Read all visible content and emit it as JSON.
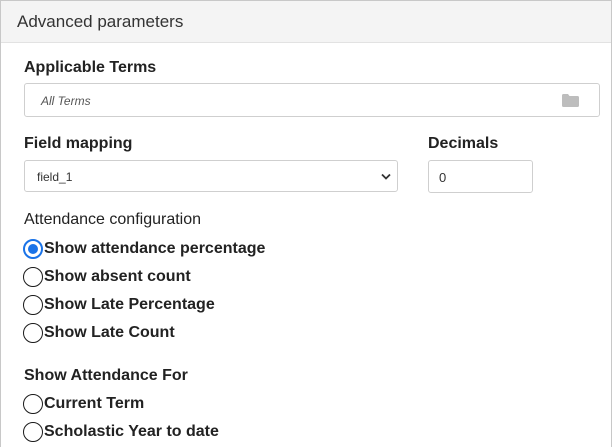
{
  "panel": {
    "title": "Advanced parameters"
  },
  "applicable_terms": {
    "label": "Applicable Terms",
    "value": "All Terms",
    "icon": "folder-icon"
  },
  "field_mapping": {
    "label": "Field mapping",
    "selected": "field_1"
  },
  "decimals": {
    "label": "Decimals",
    "value": "0"
  },
  "attendance_configuration": {
    "label": "Attendance configuration",
    "options": [
      {
        "label": "Show attendance percentage",
        "checked": true
      },
      {
        "label": "Show absent count",
        "checked": false
      },
      {
        "label": "Show Late Percentage",
        "checked": false
      },
      {
        "label": "Show Late Count",
        "checked": false
      }
    ]
  },
  "show_attendance_for": {
    "label": "Show Attendance For",
    "options": [
      {
        "label": "Current Term",
        "checked": false
      },
      {
        "label": "Scholastic Year to date",
        "checked": false
      }
    ]
  },
  "colors": {
    "accent": "#1a73e8",
    "header_bg": "#f4f4f4"
  }
}
